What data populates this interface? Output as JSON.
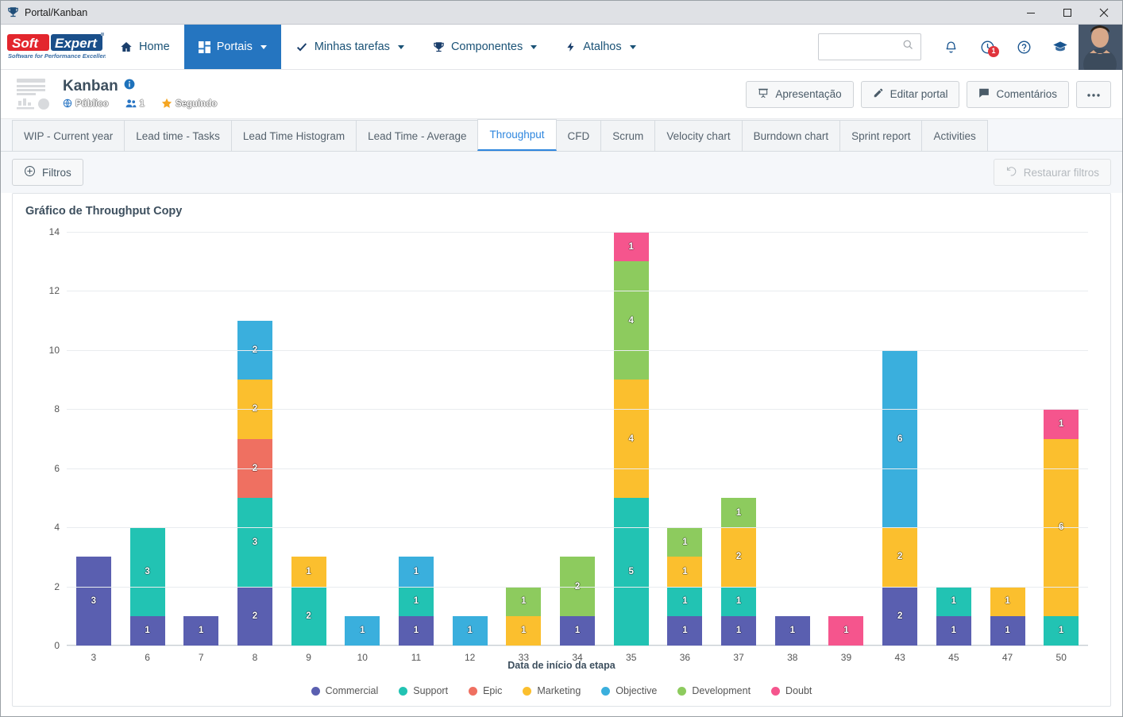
{
  "window": {
    "title": "Portal/Kanban",
    "icon": "trophy-icon",
    "minimize": "—",
    "maximize": "▢",
    "close": "✕"
  },
  "nav": {
    "logo_top": "Soft",
    "logo_top2": "Expert",
    "logo_tagline": "Software for Performance Excellence",
    "items": [
      {
        "label": "Home",
        "icon": "home-icon",
        "active": false,
        "caret": false
      },
      {
        "label": "Portais",
        "icon": "grid-icon",
        "active": true,
        "caret": true
      },
      {
        "label": "Minhas tarefas",
        "icon": "check-icon",
        "active": false,
        "caret": true
      },
      {
        "label": "Componentes",
        "icon": "trophy-icon",
        "active": false,
        "caret": true
      },
      {
        "label": "Atalhos",
        "icon": "bolt-icon",
        "active": false,
        "caret": true
      }
    ],
    "search_placeholder": "",
    "search_value": "",
    "notification_count": "1"
  },
  "portal": {
    "title": "Kanban",
    "visibility": "Público",
    "members": "1",
    "following": "Seguindo",
    "actions": [
      {
        "label": "Apresentação",
        "icon": "presentation-icon"
      },
      {
        "label": "Editar portal",
        "icon": "pencil-icon"
      },
      {
        "label": "Comentários",
        "icon": "comment-icon"
      },
      {
        "label": "",
        "icon": "more-icon"
      }
    ]
  },
  "tabs": [
    {
      "label": "WIP - Current year",
      "active": false
    },
    {
      "label": "Lead time - Tasks",
      "active": false
    },
    {
      "label": "Lead Time Histogram",
      "active": false
    },
    {
      "label": "Lead Time - Average",
      "active": false
    },
    {
      "label": "Throughput",
      "active": true
    },
    {
      "label": "CFD",
      "active": false
    },
    {
      "label": "Scrum",
      "active": false
    },
    {
      "label": "Velocity chart",
      "active": false
    },
    {
      "label": "Burndown chart",
      "active": false
    },
    {
      "label": "Sprint report",
      "active": false
    },
    {
      "label": "Activities",
      "active": false
    }
  ],
  "toolbar": {
    "filters_label": "Filtros",
    "filters_icon": "plus-circle-icon",
    "restore_label": "Restaurar filtros",
    "restore_icon": "undo-icon"
  },
  "chart_data": {
    "type": "bar",
    "stacked": true,
    "title": "Gráfico de Throughput Copy",
    "xlabel": "Data de início da etapa",
    "ylabel": "",
    "ylim": [
      0,
      14
    ],
    "yticks": [
      0,
      2,
      4,
      6,
      8,
      10,
      12,
      14
    ],
    "grid": true,
    "legend_position": "bottom",
    "categories": [
      "3",
      "6",
      "7",
      "8",
      "9",
      "10",
      "11",
      "12",
      "33",
      "34",
      "35",
      "36",
      "37",
      "38",
      "39",
      "43",
      "45",
      "47",
      "50"
    ],
    "series": [
      {
        "name": "Commercial",
        "color": "#5A5FB0",
        "values": [
          3,
          1,
          1,
          2,
          0,
          0,
          1,
          0,
          0,
          1,
          0,
          1,
          1,
          1,
          0,
          2,
          1,
          1,
          0
        ]
      },
      {
        "name": "Support",
        "color": "#22C3B3",
        "values": [
          0,
          3,
          0,
          3,
          2,
          0,
          1,
          0,
          0,
          0,
          5,
          1,
          1,
          0,
          0,
          0,
          1,
          0,
          1
        ]
      },
      {
        "name": "Epic",
        "color": "#EF7061",
        "values": [
          0,
          0,
          0,
          2,
          0,
          0,
          0,
          0,
          0,
          0,
          0,
          0,
          0,
          0,
          0,
          0,
          0,
          0,
          0
        ]
      },
      {
        "name": "Marketing",
        "color": "#FBBF2E",
        "values": [
          0,
          0,
          0,
          2,
          1,
          0,
          0,
          0,
          1,
          0,
          4,
          1,
          2,
          0,
          0,
          2,
          0,
          1,
          6
        ]
      },
      {
        "name": "Objective",
        "color": "#3AAFDD",
        "values": [
          0,
          0,
          0,
          2,
          0,
          1,
          1,
          1,
          0,
          0,
          0,
          0,
          0,
          0,
          0,
          6,
          0,
          0,
          0
        ]
      },
      {
        "name": "Development",
        "color": "#8DCB5E",
        "values": [
          0,
          0,
          0,
          0,
          0,
          0,
          0,
          0,
          1,
          2,
          4,
          1,
          1,
          0,
          0,
          0,
          0,
          0,
          0
        ]
      },
      {
        "name": "Doubt",
        "color": "#F5558D",
        "values": [
          0,
          0,
          0,
          0,
          0,
          0,
          0,
          0,
          0,
          0,
          1,
          0,
          0,
          0,
          1,
          0,
          0,
          0,
          1
        ]
      }
    ],
    "totals": [
      3,
      4,
      1,
      11,
      3,
      1,
      3,
      1,
      2,
      3,
      14,
      4,
      5,
      1,
      1,
      10,
      2,
      2,
      8
    ]
  },
  "colors": {
    "accent": "#2575c0",
    "brand_red": "#e3262d",
    "brand_blue": "#1a4f8a"
  }
}
